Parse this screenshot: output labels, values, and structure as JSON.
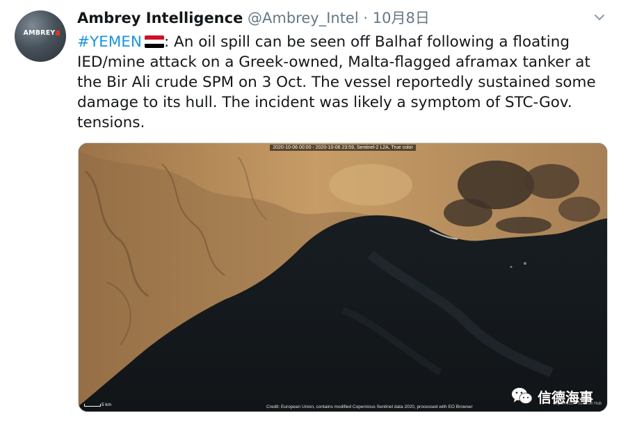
{
  "tweet": {
    "author_name": "Ambrey Intelligence",
    "author_handle": "@Ambrey_Intel",
    "separator": "·",
    "date": "10月8日",
    "avatar_text": "AMBREY",
    "hashtag": "#YEMEN",
    "body": ": An oil spill can be seen off Balhaf following a floating IED/mine attack on a Greek-owned, Malta-flagged aframax tanker at the Bir Ali crude SPM on 3 Oct. The vessel reportedly sustained some damage to its hull. The incident was likely a symptom of STC-Gov. tensions."
  },
  "media": {
    "caption": "2020-10-06 00:00 - 2020-10-06 23:59, Sentinel-2 L2A, True color",
    "credit": "Credit: European Union, contains modified Copernicus Sentinel data 2020, processed with EO Browser",
    "scale": "5 km",
    "copernicus_text": "Copernicus · Sentinel Hub"
  },
  "watermark": {
    "text": "信德海事",
    "icon": "wechat-icon"
  },
  "colors": {
    "hashtag": "#1b95e0",
    "muted": "#657786",
    "text": "#14171a",
    "flag_red": "#ce1126",
    "flag_white": "#ffffff",
    "flag_black": "#000000"
  }
}
